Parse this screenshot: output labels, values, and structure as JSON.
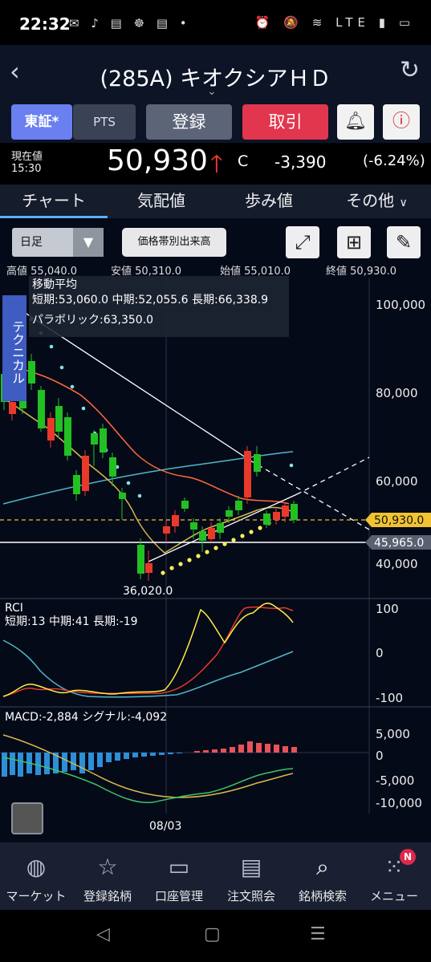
{
  "status": {
    "time": "22:32",
    "left_icons": "✉ ♪ ▤ ☸ ▤ •",
    "right_icons": "⏰ 🔕 ≋ LTE ▮ ▭"
  },
  "header": {
    "title": "(285A) キオクシアＨＤ"
  },
  "buttons": {
    "tse": "東証*",
    "pts": "PTS",
    "register": "登録",
    "trade": "取引"
  },
  "quote": {
    "current_label": "現在値",
    "time": "15:30",
    "price": "50,930",
    "flag": "C",
    "change": "-3,390",
    "change_pct": "(-6.24%)"
  },
  "tabs": [
    "チャート",
    "気配値",
    "歩み値",
    "その他"
  ],
  "chart_controls": {
    "period": "日足",
    "volume_button": "価格帯別出来高"
  },
  "ohlc": {
    "high_label": "高値",
    "high": "55,040.0",
    "low_label": "安値",
    "low": "50,310.0",
    "open_label": "始値",
    "open": "55,010.0",
    "close_label": "終値",
    "close": "50,930.0"
  },
  "technical_tab": "テクニカル",
  "overlay": {
    "ma_title": "移動平均",
    "ma_values": "短期:53,060.0 中期:52,055.6 長期:66,338.9",
    "parabolic": "パラボリック:63,350.0"
  },
  "price_axis": [
    "100,000",
    "80,000",
    "60,000",
    "40,000"
  ],
  "price_tags": {
    "last": "50,930.0",
    "line": "45,965.0",
    "low_marker": "36,020.0"
  },
  "rci": {
    "title": "RCI",
    "values": "短期:13 中期:41 長期:-19",
    "axis": [
      "100",
      "0",
      "-100"
    ]
  },
  "macd": {
    "values": "MACD:-2,884 シグナル:-4,092",
    "axis": [
      "5,000",
      "0",
      "-5,000",
      "-10,000"
    ]
  },
  "date_label": "08/03",
  "colors": {
    "up": "#22c022",
    "down": "#e8392b",
    "ma_short": "#d6b94a",
    "ma_mid": "#ff6a3a",
    "ma_long": "#4fb8c9",
    "parabolic": "#7fe3e8",
    "parabolic_low": "#ffee55",
    "tag": "#f1c232"
  },
  "chart_data": {
    "type": "candlestick",
    "y_range": [
      30000,
      100000
    ],
    "last_close": 50930,
    "horizontal_line": 45965,
    "marked_low": 36020,
    "rci_range": [
      -100,
      100
    ],
    "macd_range": [
      -10000,
      5000
    ],
    "x_label": "08/03"
  },
  "bottom_nav": [
    "マーケット",
    "登録銘柄",
    "口座管理",
    "注文照会",
    "銘柄検索",
    "メニュー"
  ],
  "menu_badge": "N",
  "icons": {
    "back": "chevron-left-icon",
    "refresh": "refresh-icon",
    "bell": "bell-icon",
    "info": "info-icon",
    "expand": "expand-icon",
    "grid": "grid-icon",
    "draw": "pencil-icon"
  }
}
